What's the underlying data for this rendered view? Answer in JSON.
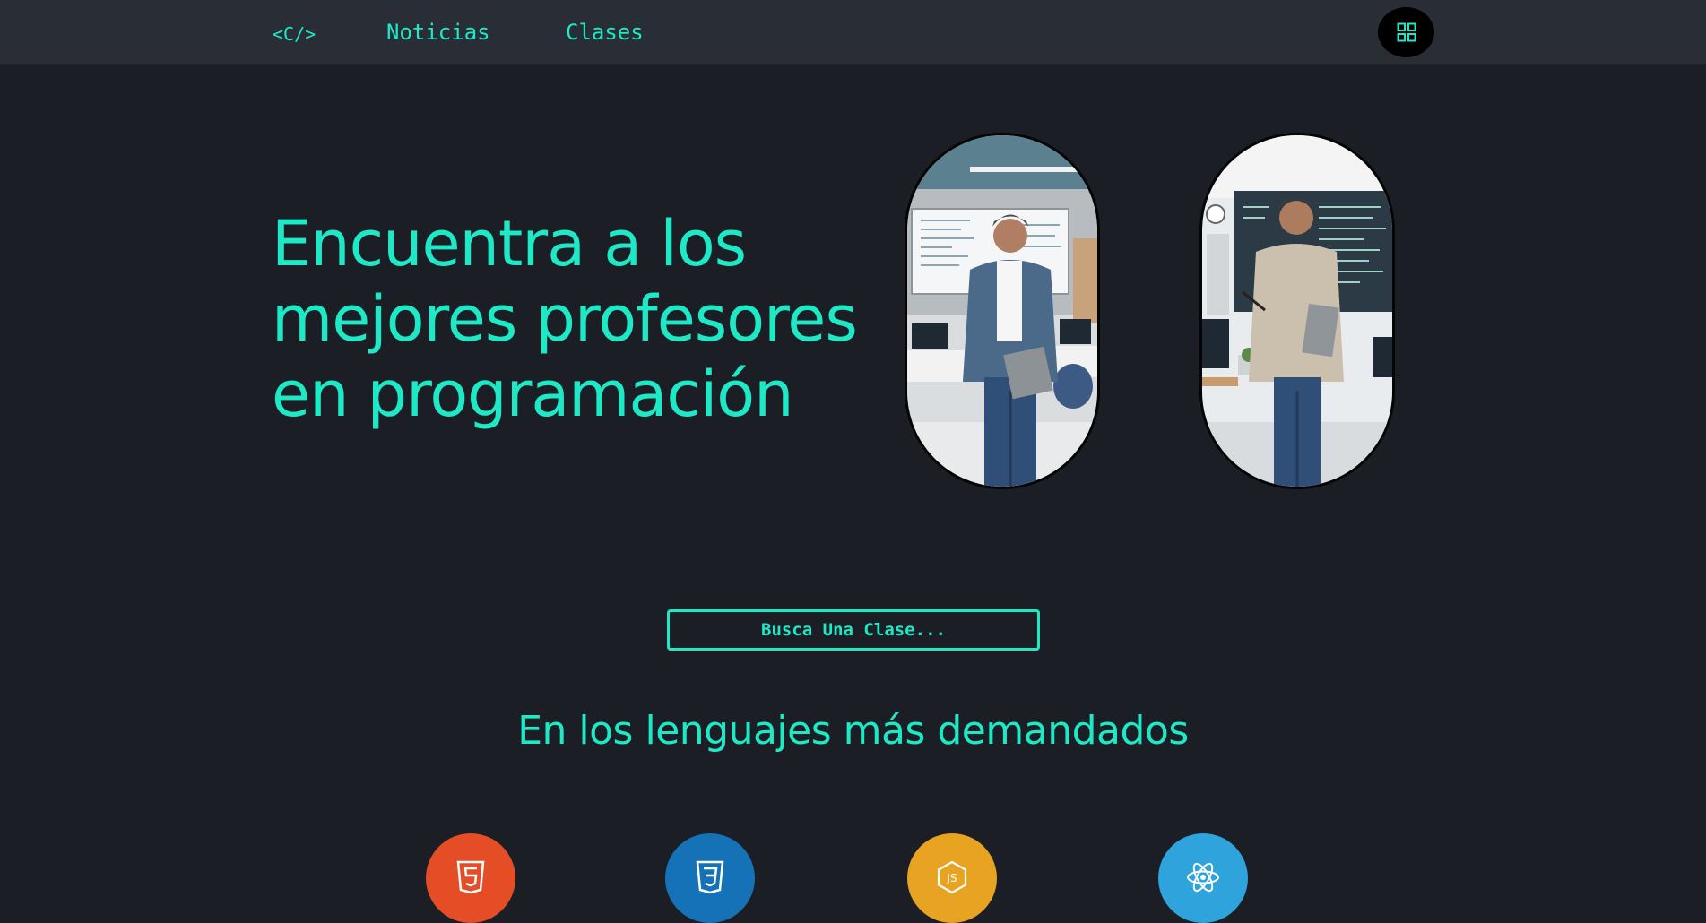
{
  "nav": {
    "logo": "<C/>",
    "links": [
      {
        "label": "Noticias"
      },
      {
        "label": "Clases"
      }
    ],
    "menu_icon": "grid-icon"
  },
  "hero": {
    "title": "Encuentra a los mejores profesores en programación"
  },
  "search": {
    "button_label": "Busca Una Clase..."
  },
  "languages": {
    "title": "En los lenguajes más demandados",
    "items": [
      {
        "icon": "html5-icon",
        "color": "#e44d26"
      },
      {
        "icon": "css3-icon",
        "color": "#1572b6"
      },
      {
        "icon": "nodejs-icon",
        "color": "#e8a323"
      },
      {
        "icon": "react-icon",
        "color": "#2ea3dc"
      }
    ]
  },
  "colors": {
    "accent": "#1de9c6",
    "background": "#1b1e24",
    "header": "#292e36"
  }
}
